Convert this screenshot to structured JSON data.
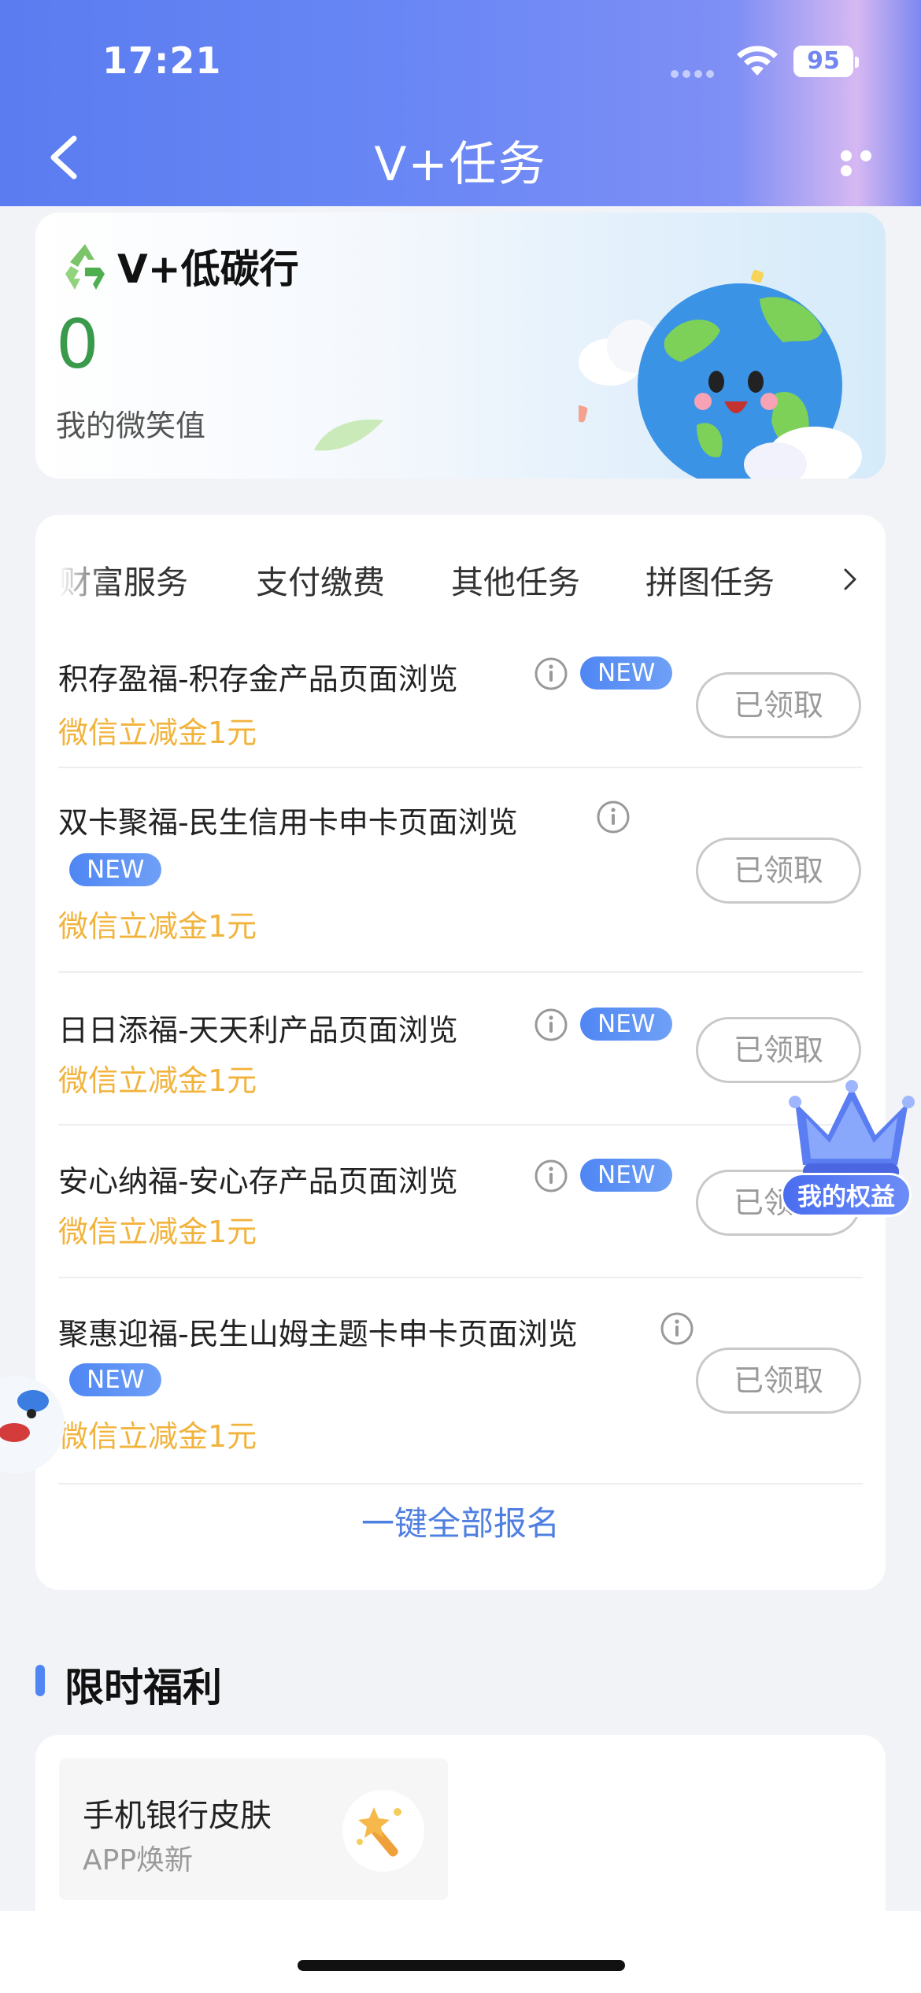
{
  "status_bar": {
    "time": "17:21",
    "battery": "95"
  },
  "nav": {
    "title": "V+任务",
    "back_icon": "chevron-left-icon",
    "more_icon": "more-dots-icon"
  },
  "banner": {
    "title": "V+低碳行",
    "smile_value": "0",
    "smile_label": "我的微笑值",
    "icon": "recycle-icon",
    "illustration": "smiling-earth-icon"
  },
  "tabs": {
    "items": [
      "财富服务",
      "支付缴费",
      "其他任务",
      "拼图任务"
    ],
    "more_icon": "chevron-right-icon"
  },
  "tasks": [
    {
      "title": "积存盈福-积存金产品页面浏览",
      "badge": "NEW",
      "reward": "微信立减金1元",
      "button": "已领取"
    },
    {
      "title": "双卡聚福-民生信用卡申卡页面浏览",
      "badge": "NEW",
      "reward": "微信立减金1元",
      "button": "已领取"
    },
    {
      "title": "日日添福-天天利产品页面浏览",
      "badge": "NEW",
      "reward": "微信立减金1元",
      "button": "已领取"
    },
    {
      "title": "安心纳福-安心存产品页面浏览",
      "badge": "NEW",
      "reward": "微信立减金1元",
      "button": "已领取"
    },
    {
      "title": "聚惠迎福-民生山姆主题卡申卡页面浏览",
      "badge": "NEW",
      "reward": "微信立减金1元",
      "button": "已领取"
    }
  ],
  "signup_all": "一键全部报名",
  "floating": {
    "label": "我的权益",
    "icon": "crown-icon"
  },
  "benefits": {
    "section_title": "限时福利",
    "items": [
      {
        "title": "手机银行皮肤",
        "subtitle": "APP焕新",
        "icon": "magic-wand-icon"
      }
    ]
  },
  "colors": {
    "header_blue": "#5a7cf0",
    "accent_blue": "#4f7fe0",
    "reward_orange": "#f2b33c",
    "smile_green": "#3a9a4c"
  }
}
